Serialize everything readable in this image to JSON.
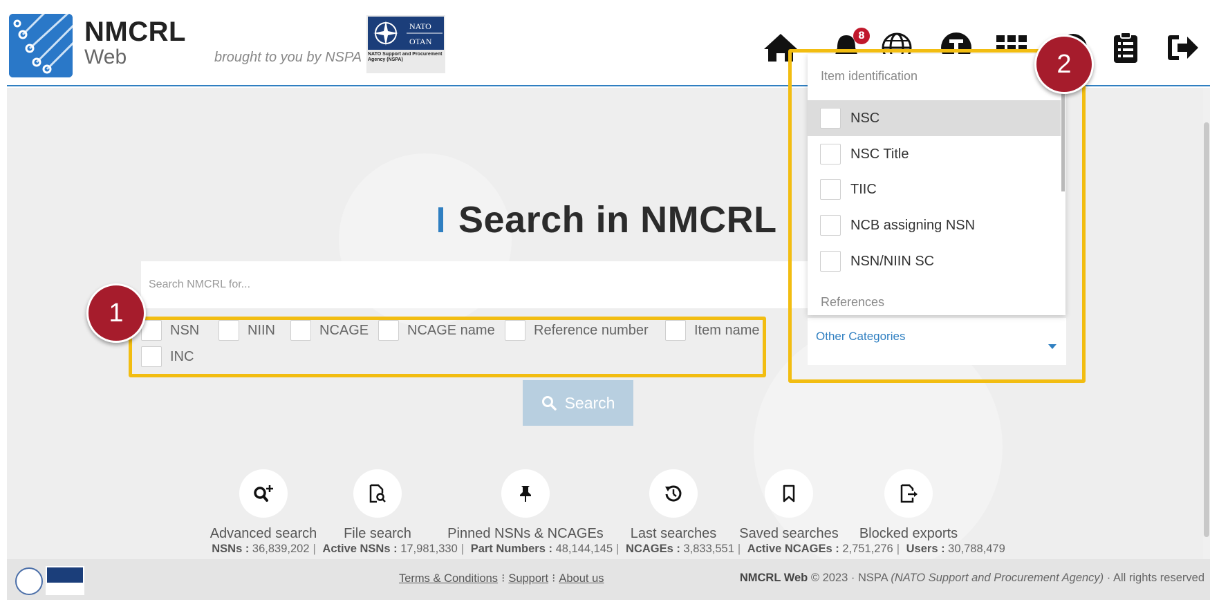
{
  "header": {
    "brand_title": "NMCRL",
    "brand_subtitle": "Web",
    "brought_by": "brought to you by NSPA",
    "nato_logo_text": [
      "NATO",
      "OTAN",
      "NATO Support and Procurement Agency (NSPA)"
    ],
    "notification_count": "8",
    "nav_icons": [
      "home-icon",
      "bell-icon",
      "globe-icon",
      "profile-icon",
      "apps-grid-icon",
      "help-icon",
      "clipboard-icon",
      "logout-icon"
    ]
  },
  "main": {
    "title": "Search in NMCRL",
    "search_placeholder": "Search NMCRL for...",
    "checkboxes": [
      "NSN",
      "NIIN",
      "NCAGE",
      "NCAGE name",
      "Reference number",
      "Item name",
      "INC"
    ],
    "other_categories_label": "Other Categories",
    "search_button_label": "Search",
    "quick_links": [
      {
        "label": "Advanced search",
        "icon": "advanced-search-icon"
      },
      {
        "label": "File search",
        "icon": "file-search-icon"
      },
      {
        "label": "Pinned NSNs & NCAGEs",
        "icon": "pin-icon"
      },
      {
        "label": "Last searches",
        "icon": "history-icon"
      },
      {
        "label": "Saved searches",
        "icon": "bookmark-icon"
      },
      {
        "label": "Blocked exports",
        "icon": "export-icon"
      }
    ],
    "stats": [
      {
        "label": "NSNs :",
        "value": "36,839,202"
      },
      {
        "label": "Active NSNs :",
        "value": "17,981,330"
      },
      {
        "label": "Part Numbers :",
        "value": "48,144,145"
      },
      {
        "label": "NCAGEs :",
        "value": "3,833,551"
      },
      {
        "label": "Active NCAGEs :",
        "value": "2,751,276"
      },
      {
        "label": "Users :",
        "value": "30,788,479"
      }
    ]
  },
  "dropdown": {
    "group1_header": "Item identification",
    "items": [
      "NSC",
      "NSC Title",
      "TIIC",
      "NCB assigning NSN",
      "NSN/NIIN SC"
    ],
    "group2_header": "References"
  },
  "footer": {
    "links": [
      "Terms & Conditions",
      "Support",
      "About us"
    ],
    "brand": "NMCRL Web",
    "copyright": "© 2023 · NSPA",
    "agency": "(NATO Support and Procurement Agency)",
    "rights": "· All rights reserved"
  },
  "annotations": {
    "marker1": "1",
    "marker2": "2"
  },
  "colors": {
    "accent": "#2f7fc1",
    "highlight": "#f2bd11",
    "marker": "#a61c2c",
    "badge": "#c0182b"
  }
}
